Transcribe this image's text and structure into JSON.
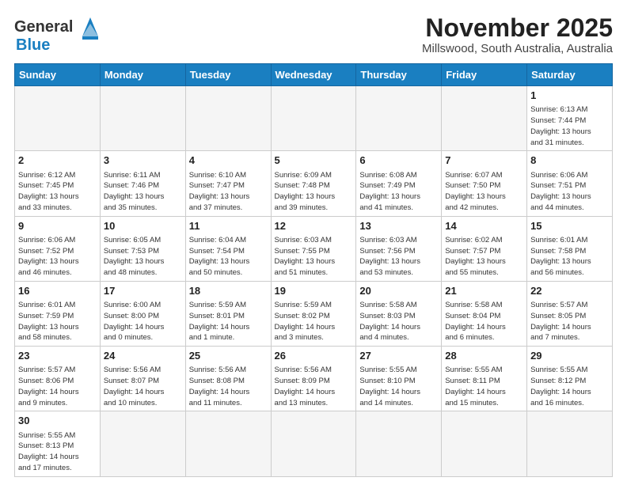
{
  "header": {
    "title": "November 2025",
    "subtitle": "Millswood, South Australia, Australia",
    "logo_general": "General",
    "logo_blue": "Blue"
  },
  "days_of_week": [
    "Sunday",
    "Monday",
    "Tuesday",
    "Wednesday",
    "Thursday",
    "Friday",
    "Saturday"
  ],
  "weeks": [
    [
      {
        "day": "",
        "info": ""
      },
      {
        "day": "",
        "info": ""
      },
      {
        "day": "",
        "info": ""
      },
      {
        "day": "",
        "info": ""
      },
      {
        "day": "",
        "info": ""
      },
      {
        "day": "",
        "info": ""
      },
      {
        "day": "1",
        "info": "Sunrise: 6:13 AM\nSunset: 7:44 PM\nDaylight: 13 hours\nand 31 minutes."
      }
    ],
    [
      {
        "day": "2",
        "info": "Sunrise: 6:12 AM\nSunset: 7:45 PM\nDaylight: 13 hours\nand 33 minutes."
      },
      {
        "day": "3",
        "info": "Sunrise: 6:11 AM\nSunset: 7:46 PM\nDaylight: 13 hours\nand 35 minutes."
      },
      {
        "day": "4",
        "info": "Sunrise: 6:10 AM\nSunset: 7:47 PM\nDaylight: 13 hours\nand 37 minutes."
      },
      {
        "day": "5",
        "info": "Sunrise: 6:09 AM\nSunset: 7:48 PM\nDaylight: 13 hours\nand 39 minutes."
      },
      {
        "day": "6",
        "info": "Sunrise: 6:08 AM\nSunset: 7:49 PM\nDaylight: 13 hours\nand 41 minutes."
      },
      {
        "day": "7",
        "info": "Sunrise: 6:07 AM\nSunset: 7:50 PM\nDaylight: 13 hours\nand 42 minutes."
      },
      {
        "day": "8",
        "info": "Sunrise: 6:06 AM\nSunset: 7:51 PM\nDaylight: 13 hours\nand 44 minutes."
      }
    ],
    [
      {
        "day": "9",
        "info": "Sunrise: 6:06 AM\nSunset: 7:52 PM\nDaylight: 13 hours\nand 46 minutes."
      },
      {
        "day": "10",
        "info": "Sunrise: 6:05 AM\nSunset: 7:53 PM\nDaylight: 13 hours\nand 48 minutes."
      },
      {
        "day": "11",
        "info": "Sunrise: 6:04 AM\nSunset: 7:54 PM\nDaylight: 13 hours\nand 50 minutes."
      },
      {
        "day": "12",
        "info": "Sunrise: 6:03 AM\nSunset: 7:55 PM\nDaylight: 13 hours\nand 51 minutes."
      },
      {
        "day": "13",
        "info": "Sunrise: 6:03 AM\nSunset: 7:56 PM\nDaylight: 13 hours\nand 53 minutes."
      },
      {
        "day": "14",
        "info": "Sunrise: 6:02 AM\nSunset: 7:57 PM\nDaylight: 13 hours\nand 55 minutes."
      },
      {
        "day": "15",
        "info": "Sunrise: 6:01 AM\nSunset: 7:58 PM\nDaylight: 13 hours\nand 56 minutes."
      }
    ],
    [
      {
        "day": "16",
        "info": "Sunrise: 6:01 AM\nSunset: 7:59 PM\nDaylight: 13 hours\nand 58 minutes."
      },
      {
        "day": "17",
        "info": "Sunrise: 6:00 AM\nSunset: 8:00 PM\nDaylight: 14 hours\nand 0 minutes."
      },
      {
        "day": "18",
        "info": "Sunrise: 5:59 AM\nSunset: 8:01 PM\nDaylight: 14 hours\nand 1 minute."
      },
      {
        "day": "19",
        "info": "Sunrise: 5:59 AM\nSunset: 8:02 PM\nDaylight: 14 hours\nand 3 minutes."
      },
      {
        "day": "20",
        "info": "Sunrise: 5:58 AM\nSunset: 8:03 PM\nDaylight: 14 hours\nand 4 minutes."
      },
      {
        "day": "21",
        "info": "Sunrise: 5:58 AM\nSunset: 8:04 PM\nDaylight: 14 hours\nand 6 minutes."
      },
      {
        "day": "22",
        "info": "Sunrise: 5:57 AM\nSunset: 8:05 PM\nDaylight: 14 hours\nand 7 minutes."
      }
    ],
    [
      {
        "day": "23",
        "info": "Sunrise: 5:57 AM\nSunset: 8:06 PM\nDaylight: 14 hours\nand 9 minutes."
      },
      {
        "day": "24",
        "info": "Sunrise: 5:56 AM\nSunset: 8:07 PM\nDaylight: 14 hours\nand 10 minutes."
      },
      {
        "day": "25",
        "info": "Sunrise: 5:56 AM\nSunset: 8:08 PM\nDaylight: 14 hours\nand 11 minutes."
      },
      {
        "day": "26",
        "info": "Sunrise: 5:56 AM\nSunset: 8:09 PM\nDaylight: 14 hours\nand 13 minutes."
      },
      {
        "day": "27",
        "info": "Sunrise: 5:55 AM\nSunset: 8:10 PM\nDaylight: 14 hours\nand 14 minutes."
      },
      {
        "day": "28",
        "info": "Sunrise: 5:55 AM\nSunset: 8:11 PM\nDaylight: 14 hours\nand 15 minutes."
      },
      {
        "day": "29",
        "info": "Sunrise: 5:55 AM\nSunset: 8:12 PM\nDaylight: 14 hours\nand 16 minutes."
      }
    ],
    [
      {
        "day": "30",
        "info": "Sunrise: 5:55 AM\nSunset: 8:13 PM\nDaylight: 14 hours\nand 17 minutes."
      },
      {
        "day": "",
        "info": ""
      },
      {
        "day": "",
        "info": ""
      },
      {
        "day": "",
        "info": ""
      },
      {
        "day": "",
        "info": ""
      },
      {
        "day": "",
        "info": ""
      },
      {
        "day": "",
        "info": ""
      }
    ]
  ]
}
